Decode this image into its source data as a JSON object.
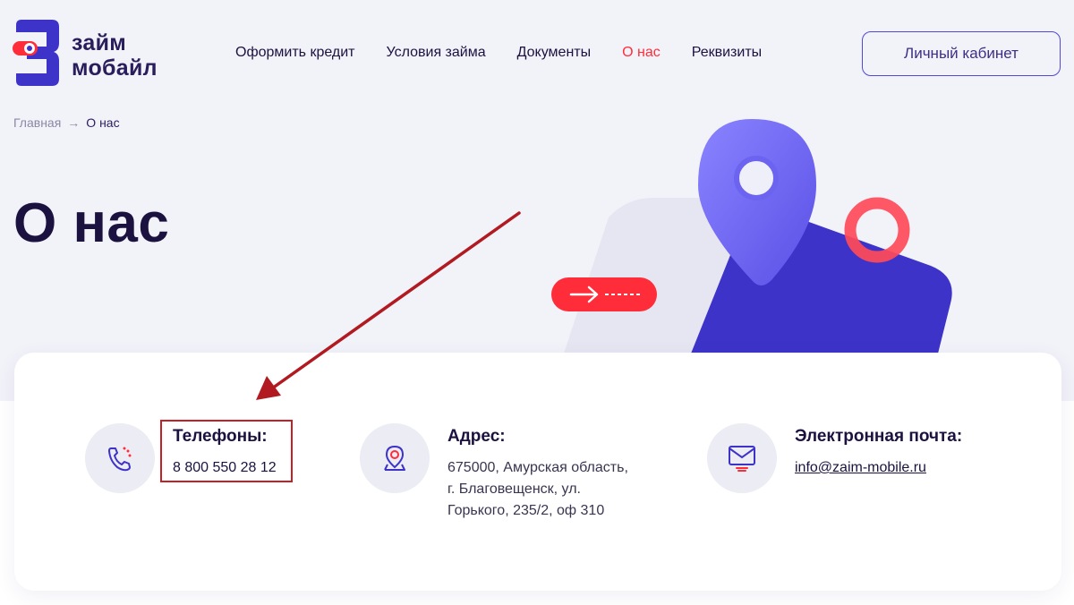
{
  "header": {
    "logo_line1": "займ",
    "logo_line2": "мобайл",
    "nav": [
      {
        "label": "Оформить кредит",
        "active": false
      },
      {
        "label": "Условия займа",
        "active": false
      },
      {
        "label": "Документы",
        "active": false
      },
      {
        "label": "О нас",
        "active": true
      },
      {
        "label": "Реквизиты",
        "active": false
      }
    ],
    "cabinet_label": "Личный кабинет"
  },
  "breadcrumb": {
    "home": "Главная",
    "current": "О нас"
  },
  "page": {
    "title": "О нас"
  },
  "contacts": {
    "phones": {
      "title": "Телефоны:",
      "value": "8 800 550 28 12",
      "icon": "phone-icon"
    },
    "address": {
      "title": "Адрес:",
      "lines": [
        "675000, Амурская область,",
        "г. Благовещенск, ул.",
        "Горького, 235/2, оф 310"
      ],
      "icon": "location-pin-icon"
    },
    "email": {
      "title": "Электронная почта:",
      "value": "info@zaim-mobile.ru",
      "icon": "monitor-mail-icon"
    }
  },
  "colors": {
    "accent_red": "#ff2d3a",
    "brand_purple": "#3d33c9",
    "annotation_red": "#c42026"
  }
}
